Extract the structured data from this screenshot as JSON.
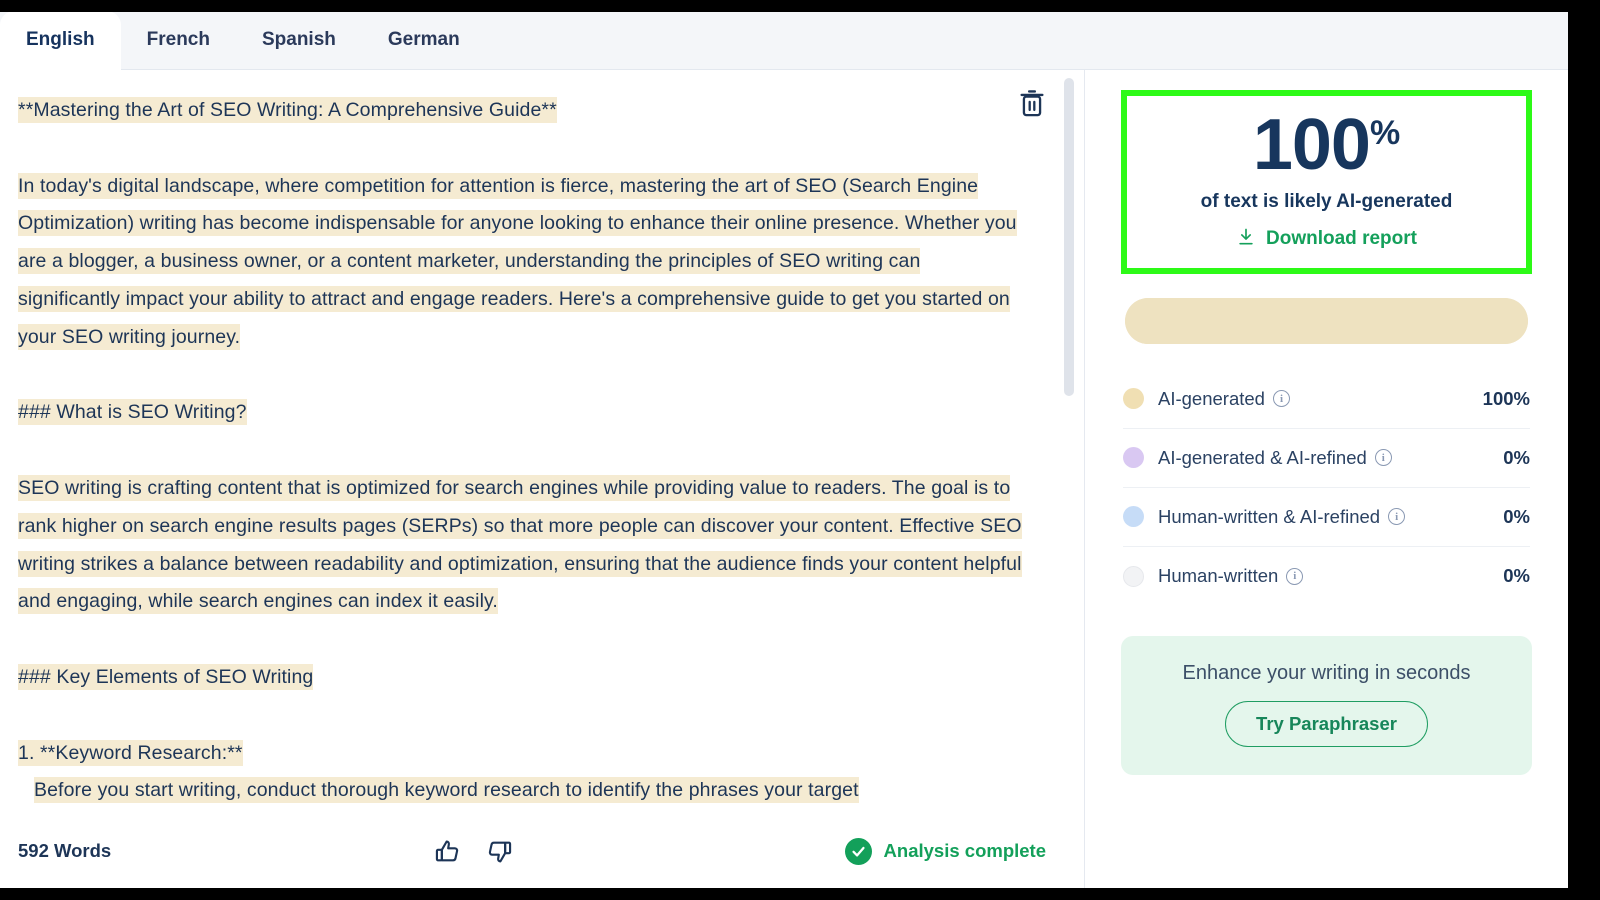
{
  "tabs": [
    {
      "label": "English",
      "active": true
    },
    {
      "label": "French",
      "active": false
    },
    {
      "label": "Spanish",
      "active": false
    },
    {
      "label": "German",
      "active": false
    }
  ],
  "editor": {
    "trash_icon": "trash-icon",
    "blocks": [
      {
        "type": "line",
        "text": "**Mastering the Art of SEO Writing: A Comprehensive Guide**",
        "highlighted": true,
        "indent": false
      },
      {
        "type": "gap"
      },
      {
        "type": "para",
        "text": "In today's digital landscape, where competition for attention is fierce, mastering the art of SEO (Search Engine Optimization) writing has become indispensable for anyone looking to enhance their online presence. Whether you are a blogger, a business owner, or a content marketer, understanding the principles of SEO writing can significantly impact your ability to attract and engage readers. Here's a comprehensive guide to get you started on your SEO writing journey.",
        "highlighted": true,
        "indent": false
      },
      {
        "type": "gap"
      },
      {
        "type": "line",
        "text": "### What is SEO Writing?",
        "highlighted": true,
        "indent": false
      },
      {
        "type": "gap"
      },
      {
        "type": "para",
        "text": "SEO writing is crafting content that is optimized for search engines while providing value to readers. The goal is to rank higher on search engine results pages (SERPs) so that more people can discover your content. Effective SEO writing strikes a balance between readability and optimization, ensuring that the audience finds your content helpful and engaging, while search engines can index it easily.",
        "highlighted": true,
        "indent": false
      },
      {
        "type": "gap"
      },
      {
        "type": "line",
        "text": "### Key Elements of SEO Writing",
        "highlighted": true,
        "indent": false
      },
      {
        "type": "gap"
      },
      {
        "type": "line",
        "text": "1. **Keyword Research:**",
        "highlighted": true,
        "indent": false
      },
      {
        "type": "line",
        "text": "Before you start writing, conduct thorough keyword research to identify the phrases your target",
        "highlighted": true,
        "indent": true
      }
    ],
    "scrollbar": {
      "name": "editor-scrollbar"
    }
  },
  "footer": {
    "word_count": "592 Words",
    "thumbs_up_icon": "thumbs-up-icon",
    "thumbs_down_icon": "thumbs-down-icon",
    "status_text": "Analysis complete",
    "status_color": "#13a05a"
  },
  "results": {
    "highlight_border_color": "#2dfa17",
    "score_value": "100",
    "score_unit": "%",
    "score_subtitle": "of text is likely AI-generated",
    "download_label": "Download report",
    "download_icon": "download-icon",
    "meter_percent": 100,
    "meter_color": "#eee2c0",
    "legend": [
      {
        "label": "AI-generated",
        "value": "100%",
        "color": "#f0dfb3",
        "info_icon": "info-icon"
      },
      {
        "label": "AI-generated & AI-refined",
        "value": "0%",
        "color": "#d9c8f2",
        "info_icon": "info-icon"
      },
      {
        "label": "Human-written & AI-refined",
        "value": "0%",
        "color": "#c6dcf7",
        "info_icon": "info-icon"
      },
      {
        "label": "Human-written",
        "value": "0%",
        "color": "#f2f3f5",
        "info_icon": "info-icon"
      }
    ],
    "promo": {
      "text": "Enhance your writing in seconds",
      "button_label": "Try Paraphraser"
    }
  }
}
